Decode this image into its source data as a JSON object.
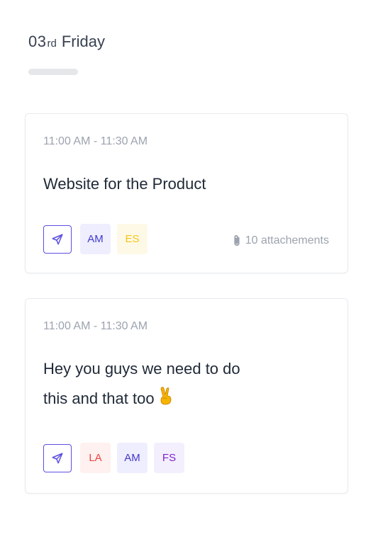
{
  "header": {
    "day_number": "03",
    "day_suffix": "rd",
    "day_name": "Friday"
  },
  "events": [
    {
      "time": "11:00 AM - 11:30 AM",
      "title": "Website for the Product",
      "avatars": [
        "AM",
        "ES"
      ],
      "attachments": "10 attachements"
    },
    {
      "time": "11:00 AM - 11:30 AM",
      "title_line1": "Hey you guys we need to do",
      "title_line2": "this and that too",
      "avatars": [
        "LA",
        "AM",
        "FS"
      ]
    }
  ],
  "icons": {
    "send": "send-icon",
    "attachment": "paperclip-icon",
    "emoji": "victory-hand-icon"
  },
  "colors": {
    "accent": "#5b4fe0",
    "am": "#4338ca",
    "es": "#f5c518",
    "la": "#ef4444",
    "fs": "#7e22ce"
  }
}
